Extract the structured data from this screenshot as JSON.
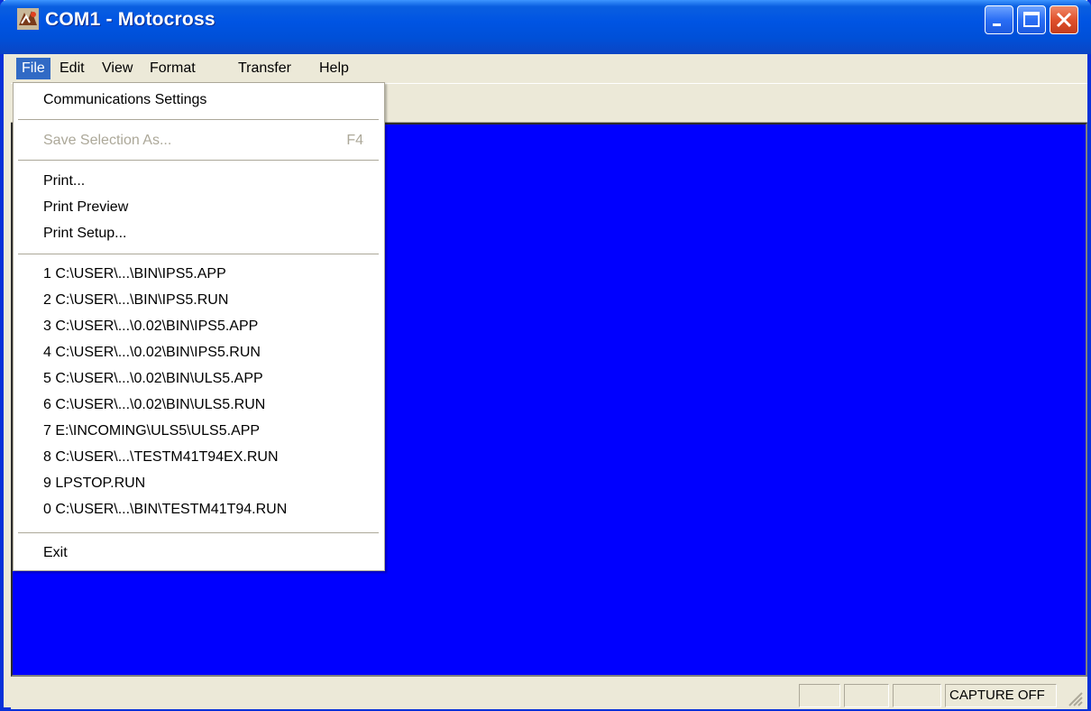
{
  "window": {
    "title": "COM1 - Motocross"
  },
  "title_buttons": [
    {
      "name": "minimize-button",
      "icon": "minimize-icon"
    },
    {
      "name": "maximize-button",
      "icon": "maximize-icon"
    },
    {
      "name": "close-button",
      "icon": "close-icon"
    }
  ],
  "menubar": {
    "items": [
      "File",
      "Edit",
      "View",
      "Format",
      "Transfer",
      "Help"
    ],
    "active": "File"
  },
  "file_menu": {
    "communications_settings": "Communications Settings",
    "save_selection_as": "Save Selection As...",
    "save_selection_shortcut": "F4",
    "print": "Print...",
    "print_preview": "Print Preview",
    "print_setup": "Print Setup...",
    "recent_files": [
      "1 C:\\USER\\...\\BIN\\IPS5.APP",
      "2 C:\\USER\\...\\BIN\\IPS5.RUN",
      "3 C:\\USER\\...\\0.02\\BIN\\IPS5.APP",
      "4 C:\\USER\\...\\0.02\\BIN\\IPS5.RUN",
      "5 C:\\USER\\...\\0.02\\BIN\\ULS5.APP",
      "6 C:\\USER\\...\\0.02\\BIN\\ULS5.RUN",
      "7 E:\\INCOMING\\ULS5\\ULS5.APP",
      "8 C:\\USER\\...\\TESTM41T94EX.RUN",
      "9 LPSTOP.RUN",
      "0 C:\\USER\\...\\BIN\\TESTM41T94.RUN"
    ],
    "exit": "Exit"
  },
  "statusbar": {
    "capture": "CAPTURE OFF"
  },
  "colors": {
    "terminal_bg": "#0000ff",
    "menu_highlight": "#316ac5",
    "title_bar": "#0054e3",
    "disabled_text": "#aca899"
  }
}
